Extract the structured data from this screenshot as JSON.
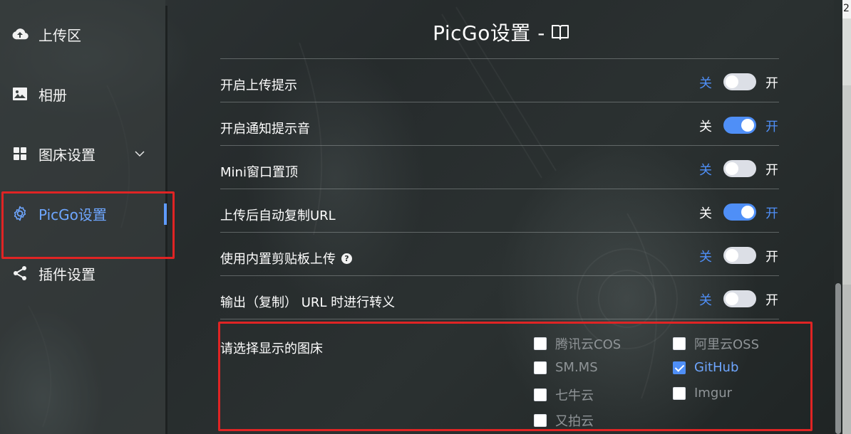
{
  "sidebar": {
    "items": [
      {
        "label": "上传区",
        "icon": "cloud-upload-icon"
      },
      {
        "label": "相册",
        "icon": "image-icon"
      },
      {
        "label": "图床设置",
        "icon": "grid-icon"
      },
      {
        "label": "PicGo设置",
        "icon": "gear-icon"
      },
      {
        "label": "插件设置",
        "icon": "share-icon"
      }
    ],
    "active_index": 3
  },
  "page": {
    "title": "PicGo设置 -",
    "title_icon": "book-icon"
  },
  "switch_text": {
    "off": "关",
    "on": "开"
  },
  "settings": [
    {
      "label": "开启上传提示",
      "on": false
    },
    {
      "label": "开启通知提示音",
      "on": true
    },
    {
      "label": "Mini窗口置顶",
      "on": false
    },
    {
      "label": "上传后自动复制URL",
      "on": true
    },
    {
      "label": "使用内置剪贴板上传",
      "on": false,
      "help": "?"
    },
    {
      "label": "输出（复制） URL 时进行转义",
      "on": false
    }
  ],
  "picbed_select": {
    "label": "请选择显示的图床",
    "options": [
      {
        "label": "腾讯云COS",
        "checked": false
      },
      {
        "label": "阿里云OSS",
        "checked": false
      },
      {
        "label": "SM.MS",
        "checked": false
      },
      {
        "label": "GitHub",
        "checked": true
      },
      {
        "label": "七牛云",
        "checked": false
      },
      {
        "label": "Imgur",
        "checked": false
      },
      {
        "label": "又拍云",
        "checked": false
      }
    ]
  },
  "edge_text": "2",
  "colors": {
    "accent": "#4f8ff7",
    "highlight": "#e02424",
    "active_nav": "#6ea6ff"
  }
}
